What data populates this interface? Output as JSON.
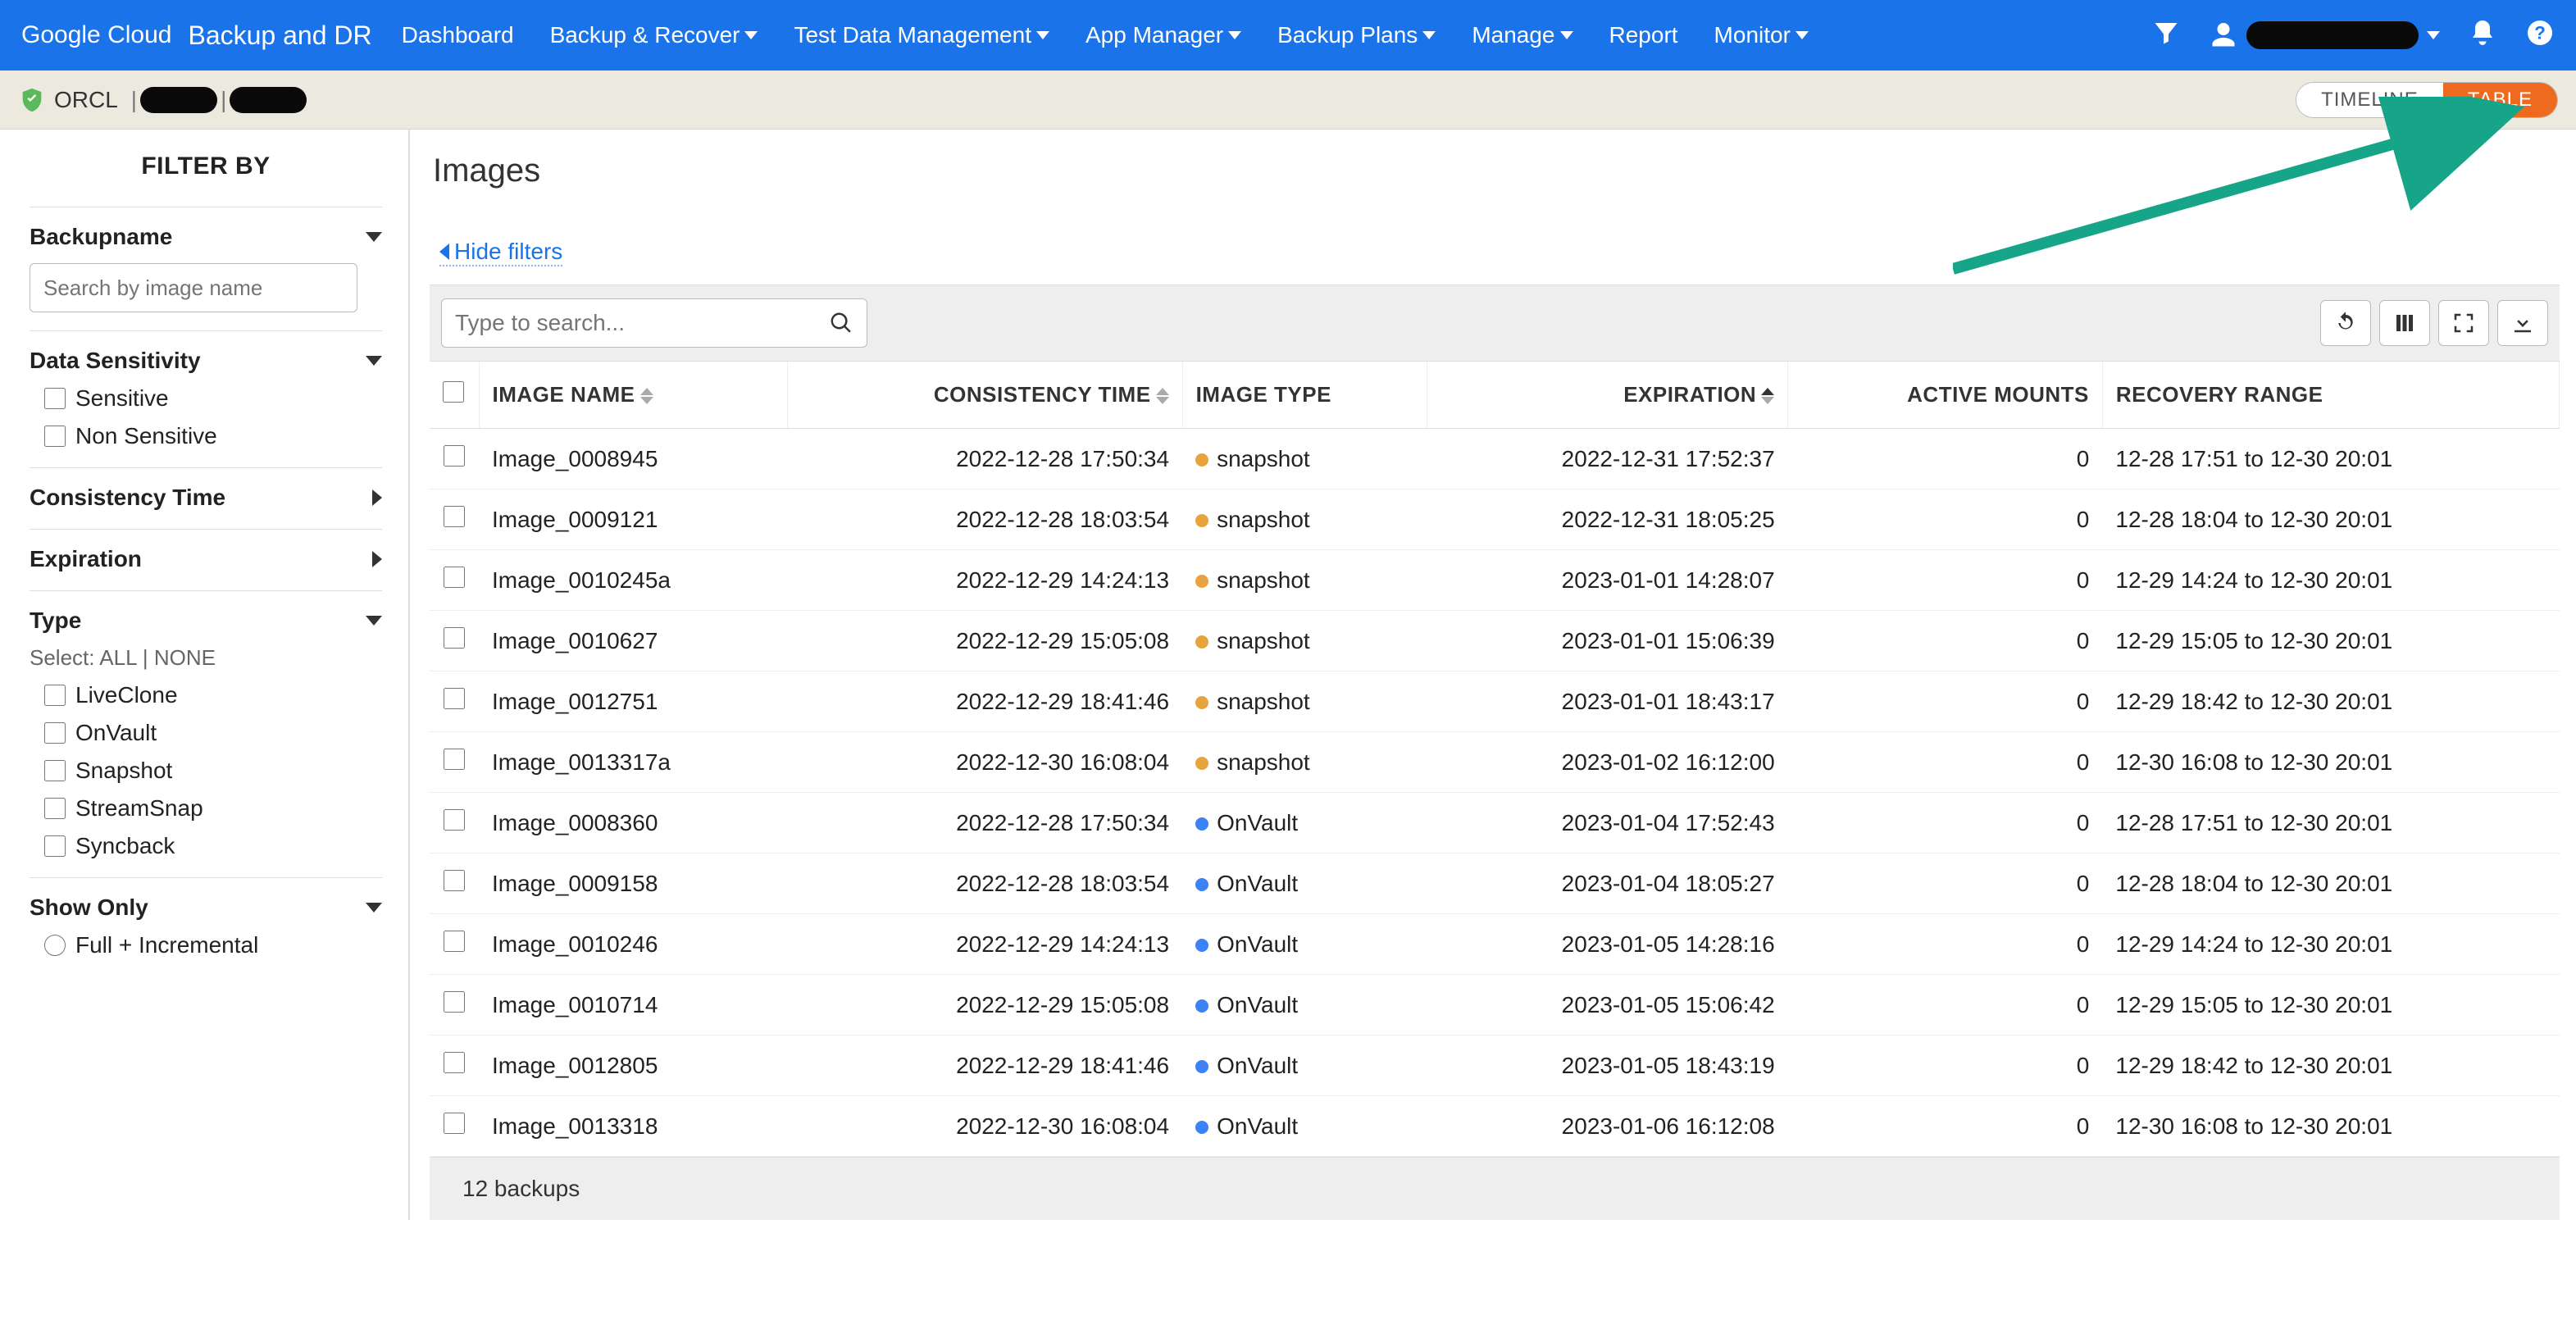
{
  "topnav": {
    "logo_google": "Google",
    "logo_cloud": "Cloud",
    "product": "Backup and DR",
    "items": [
      {
        "label": "Dashboard",
        "dropdown": false
      },
      {
        "label": "Backup & Recover",
        "dropdown": true
      },
      {
        "label": "Test Data Management",
        "dropdown": true
      },
      {
        "label": "App Manager",
        "dropdown": true
      },
      {
        "label": "Backup Plans",
        "dropdown": true
      },
      {
        "label": "Manage",
        "dropdown": true
      },
      {
        "label": "Report",
        "dropdown": false
      },
      {
        "label": "Monitor",
        "dropdown": true
      }
    ]
  },
  "subheader": {
    "app_name": "ORCL",
    "toggle_timeline": "TIMELINE",
    "toggle_table": "TABLE"
  },
  "sidebar": {
    "title": "FILTER BY",
    "backupname": {
      "label": "Backupname",
      "placeholder": "Search by image name"
    },
    "data_sensitivity": {
      "label": "Data Sensitivity",
      "opts": [
        "Sensitive",
        "Non Sensitive"
      ]
    },
    "consistency_time": {
      "label": "Consistency Time"
    },
    "expiration": {
      "label": "Expiration"
    },
    "type": {
      "label": "Type",
      "select_prefix": "Select:",
      "select_all": "ALL",
      "select_sep": "|",
      "select_none": "NONE",
      "opts": [
        "LiveClone",
        "OnVault",
        "Snapshot",
        "StreamSnap",
        "Syncback"
      ]
    },
    "show_only": {
      "label": "Show Only",
      "opt": "Full + Incremental"
    }
  },
  "main": {
    "title": "Images",
    "hide_filters": "Hide filters",
    "search_placeholder": "Type to search...",
    "columns": {
      "image_name": "IMAGE NAME",
      "consistency_time": "CONSISTENCY TIME",
      "image_type": "IMAGE TYPE",
      "expiration": "EXPIRATION",
      "active_mounts": "ACTIVE MOUNTS",
      "recovery_range": "RECOVERY RANGE"
    },
    "rows": [
      {
        "name": "Image_0008945",
        "ct": "2022-12-28 17:50:34",
        "type": "snapshot",
        "dot": "orange",
        "exp": "2022-12-31 17:52:37",
        "am": "0",
        "rr": "12-28 17:51 to 12-30 20:01"
      },
      {
        "name": "Image_0009121",
        "ct": "2022-12-28 18:03:54",
        "type": "snapshot",
        "dot": "orange",
        "exp": "2022-12-31 18:05:25",
        "am": "0",
        "rr": "12-28 18:04 to 12-30 20:01"
      },
      {
        "name": "Image_0010245a",
        "ct": "2022-12-29 14:24:13",
        "type": "snapshot",
        "dot": "orange",
        "exp": "2023-01-01 14:28:07",
        "am": "0",
        "rr": "12-29 14:24 to 12-30 20:01"
      },
      {
        "name": "Image_0010627",
        "ct": "2022-12-29 15:05:08",
        "type": "snapshot",
        "dot": "orange",
        "exp": "2023-01-01 15:06:39",
        "am": "0",
        "rr": "12-29 15:05 to 12-30 20:01"
      },
      {
        "name": "Image_0012751",
        "ct": "2022-12-29 18:41:46",
        "type": "snapshot",
        "dot": "orange",
        "exp": "2023-01-01 18:43:17",
        "am": "0",
        "rr": "12-29 18:42 to 12-30 20:01"
      },
      {
        "name": "Image_0013317a",
        "ct": "2022-12-30 16:08:04",
        "type": "snapshot",
        "dot": "orange",
        "exp": "2023-01-02 16:12:00",
        "am": "0",
        "rr": "12-30 16:08 to 12-30 20:01"
      },
      {
        "name": "Image_0008360",
        "ct": "2022-12-28 17:50:34",
        "type": "OnVault",
        "dot": "blue",
        "exp": "2023-01-04 17:52:43",
        "am": "0",
        "rr": "12-28 17:51 to 12-30 20:01"
      },
      {
        "name": "Image_0009158",
        "ct": "2022-12-28 18:03:54",
        "type": "OnVault",
        "dot": "blue",
        "exp": "2023-01-04 18:05:27",
        "am": "0",
        "rr": "12-28 18:04 to 12-30 20:01"
      },
      {
        "name": "Image_0010246",
        "ct": "2022-12-29 14:24:13",
        "type": "OnVault",
        "dot": "blue",
        "exp": "2023-01-05 14:28:16",
        "am": "0",
        "rr": "12-29 14:24 to 12-30 20:01"
      },
      {
        "name": "Image_0010714",
        "ct": "2022-12-29 15:05:08",
        "type": "OnVault",
        "dot": "blue",
        "exp": "2023-01-05 15:06:42",
        "am": "0",
        "rr": "12-29 15:05 to 12-30 20:01"
      },
      {
        "name": "Image_0012805",
        "ct": "2022-12-29 18:41:46",
        "type": "OnVault",
        "dot": "blue",
        "exp": "2023-01-05 18:43:19",
        "am": "0",
        "rr": "12-29 18:42 to 12-30 20:01"
      },
      {
        "name": "Image_0013318",
        "ct": "2022-12-30 16:08:04",
        "type": "OnVault",
        "dot": "blue",
        "exp": "2023-01-06 16:12:08",
        "am": "0",
        "rr": "12-30 16:08 to 12-30 20:01"
      }
    ],
    "footer": "12 backups"
  }
}
